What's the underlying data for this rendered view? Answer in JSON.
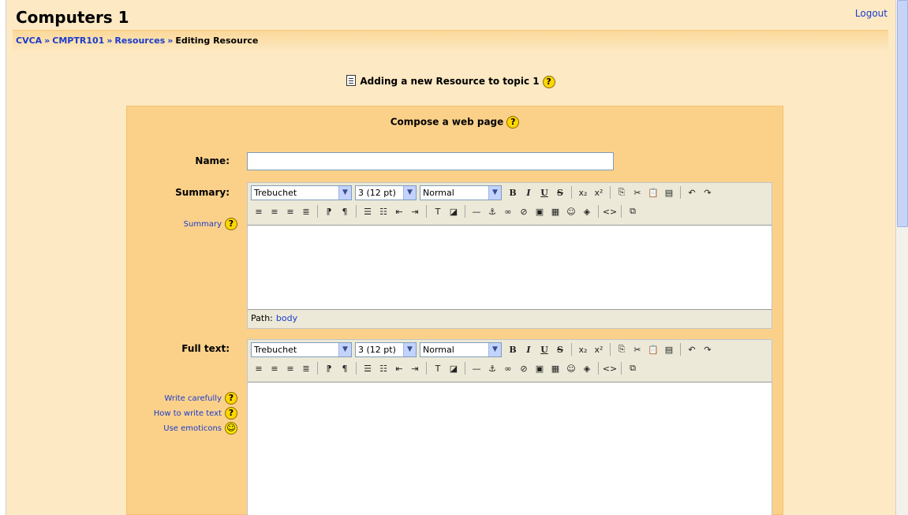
{
  "header": {
    "site_title": "Computers 1",
    "logout_label": "Logout"
  },
  "breadcrumb": {
    "items": [
      "CVCA",
      "CMPTR101",
      "Resources"
    ],
    "current": "Editing Resource",
    "separator": "»"
  },
  "page": {
    "heading": "Adding a new Resource to topic 1"
  },
  "form": {
    "title": "Compose a web page",
    "name_label": "Name:",
    "name_value": "",
    "summary_label": "Summary:",
    "summary_help_link": "Summary",
    "fulltext_label": "Full text:",
    "fulltext_help_links": [
      "Write carefully",
      "How to write text",
      "Use emoticons"
    ]
  },
  "editor": {
    "font_value": "Trebuchet",
    "size_value": "3 (12 pt)",
    "style_value": "Normal",
    "path_label": "Path:",
    "path_value": "body"
  },
  "icons": {
    "help": "help-icon",
    "smiley": "smiley-icon",
    "document": "document-icon"
  },
  "colors": {
    "page_bg": "#fde9c4",
    "form_bg": "#fbd18a",
    "link": "#1a3ccc"
  }
}
